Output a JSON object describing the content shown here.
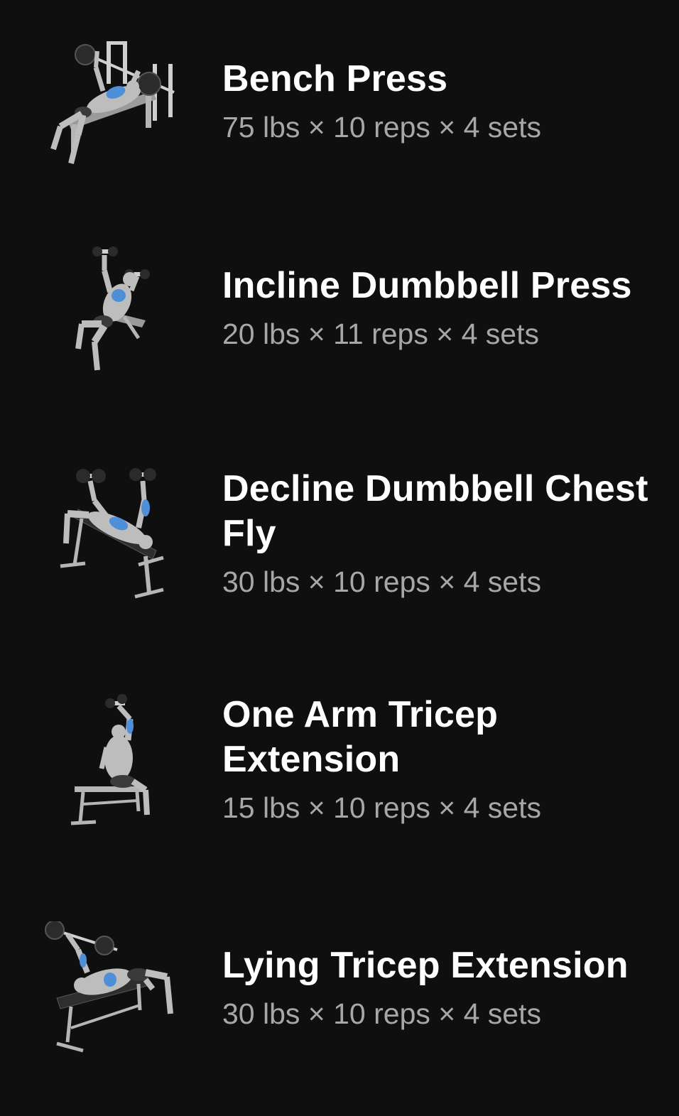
{
  "colors": {
    "background": "#0f0f0f",
    "title": "#ffffff",
    "detail": "#a7a7a7",
    "muscle_highlight": "#4f8fd8"
  },
  "exercises": [
    {
      "icon": "bench-press-icon",
      "name": "Bench Press",
      "detail": "75 lbs × 10 reps × 4 sets"
    },
    {
      "icon": "incline-dumbbell-press-icon",
      "name": "Incline Dumbbell Press",
      "detail": "20 lbs × 11 reps × 4 sets"
    },
    {
      "icon": "decline-dumbbell-chest-fly-icon",
      "name": "Decline Dumbbell Chest Fly",
      "detail": "30 lbs × 10 reps × 4 sets"
    },
    {
      "icon": "one-arm-tricep-extension-icon",
      "name": "One Arm Tricep Extension",
      "detail": "15 lbs × 10 reps × 4 sets"
    },
    {
      "icon": "lying-tricep-extension-icon",
      "name": "Lying Tricep Extension",
      "detail": "30 lbs × 10 reps × 4 sets"
    }
  ]
}
